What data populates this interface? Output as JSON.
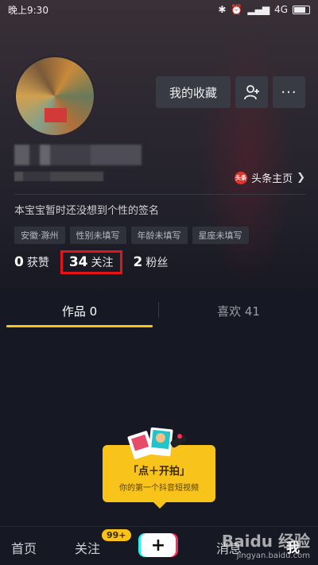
{
  "status_bar": {
    "time": "晚上9:30",
    "network": "4G"
  },
  "profile": {
    "favorites_label": "我的收藏",
    "more_label": "···",
    "toutiao_logo": "头条",
    "toutiao_label": "头条主页",
    "signature": "本宝宝暂时还没想到个性的签名",
    "tags": [
      "安徽·滁州",
      "性别未填写",
      "年龄未填写",
      "星座未填写"
    ]
  },
  "stats": {
    "likes_num": "0",
    "likes_label": "获赞",
    "following_num": "34",
    "following_label": "关注",
    "followers_num": "2",
    "followers_label": "粉丝"
  },
  "tabs": {
    "works": "作品 0",
    "likes": "喜欢 41"
  },
  "promo": {
    "title": "「点＋开拍」",
    "subtitle": "你的第一个抖音短视频"
  },
  "bottom_nav": {
    "home": "首页",
    "follow": "关注",
    "follow_badge": "99+",
    "plus": "+",
    "messages": "消息",
    "me": "我"
  },
  "watermark": {
    "main": "Baidu 经验",
    "sub": "jingyan.baidu.com"
  },
  "colors": {
    "accent_yellow": "#f9c21b",
    "highlight_red": "#e4141b",
    "background": "#161823"
  }
}
